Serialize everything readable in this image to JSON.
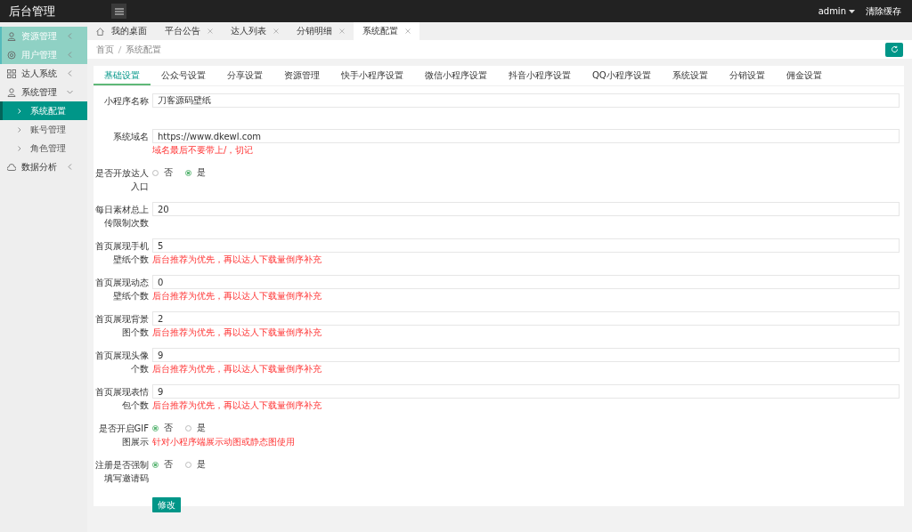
{
  "app_title": "后台管理",
  "header_user": "admin",
  "header_action": "清除缓存",
  "sidebar": [
    {
      "label": "资源管理",
      "highlighted": true,
      "expanded": false
    },
    {
      "label": "用户管理",
      "highlighted": true,
      "expanded": false
    },
    {
      "label": "达人系统",
      "highlighted": false,
      "expanded": false
    },
    {
      "label": "系统管理",
      "highlighted": false,
      "expanded": true,
      "children": [
        {
          "label": "系统配置",
          "selected": true
        },
        {
          "label": "账号管理",
          "selected": false
        },
        {
          "label": "角色管理",
          "selected": false
        }
      ]
    },
    {
      "label": "数据分析",
      "highlighted": false,
      "expanded": false
    }
  ],
  "page_tabs": [
    {
      "label": "我的桌面",
      "kind": "home",
      "selected": false
    },
    {
      "label": "平台公告",
      "kind": "closable",
      "selected": false
    },
    {
      "label": "达人列表",
      "kind": "closable",
      "selected": false
    },
    {
      "label": "分销明细",
      "kind": "closable",
      "selected": false
    },
    {
      "label": "系统配置",
      "kind": "closable",
      "selected": true
    }
  ],
  "breadcrumb": [
    "首页",
    "系统配置"
  ],
  "settings_tabs": [
    {
      "label": "基础设置",
      "selected": true
    },
    {
      "label": "公众号设置",
      "selected": false
    },
    {
      "label": "分享设置",
      "selected": false
    },
    {
      "label": "资源管理",
      "selected": false
    },
    {
      "label": "快手小程序设置",
      "selected": false
    },
    {
      "label": "微信小程序设置",
      "selected": false
    },
    {
      "label": "抖音小程序设置",
      "selected": false
    },
    {
      "label": "QQ小程序设置",
      "selected": false
    },
    {
      "label": "系统设置",
      "selected": false
    },
    {
      "label": "分销设置",
      "selected": false
    },
    {
      "label": "佣金设置",
      "selected": false
    }
  ],
  "form": [
    {
      "kind": "text",
      "label": "小程序名称",
      "value": "刀客源码壁纸"
    },
    {
      "kind": "text",
      "label": "系统域名",
      "value": "https://www.dkewl.com",
      "hint": "域名最后不要带上/，切记"
    },
    {
      "kind": "radio",
      "label": "是否开放达人入口",
      "options": [
        {
          "label": "否",
          "selected": false
        },
        {
          "label": "是",
          "selected": true
        }
      ]
    },
    {
      "kind": "text",
      "label": "每日素材总上传限制次数",
      "value": "20"
    },
    {
      "kind": "text",
      "label": "首页展现手机壁纸个数",
      "value": "5",
      "hint": "后台推荐为优先，再以达人下载量倒序补充"
    },
    {
      "kind": "text",
      "label": "首页展现动态壁纸个数",
      "value": "0",
      "hint": "后台推荐为优先，再以达人下载量倒序补充"
    },
    {
      "kind": "text",
      "label": "首页展现背景图个数",
      "value": "2",
      "hint": "后台推荐为优先，再以达人下载量倒序补充"
    },
    {
      "kind": "text",
      "label": "首页展现头像个数",
      "value": "9",
      "hint": "后台推荐为优先，再以达人下载量倒序补充"
    },
    {
      "kind": "text",
      "label": "首页展现表情包个数",
      "value": "9",
      "hint": "后台推荐为优先，再以达人下载量倒序补充"
    },
    {
      "kind": "radio",
      "label": "是否开启GIF图展示",
      "options": [
        {
          "label": "否",
          "selected": true
        },
        {
          "label": "是",
          "selected": false
        }
      ],
      "hint": "针对小程序端展示动图或静态图使用"
    },
    {
      "kind": "radio",
      "label": "注册是否强制填写邀请码",
      "options": [
        {
          "label": "否",
          "selected": true
        },
        {
          "label": "是",
          "selected": false
        }
      ]
    }
  ],
  "submit": "修改"
}
